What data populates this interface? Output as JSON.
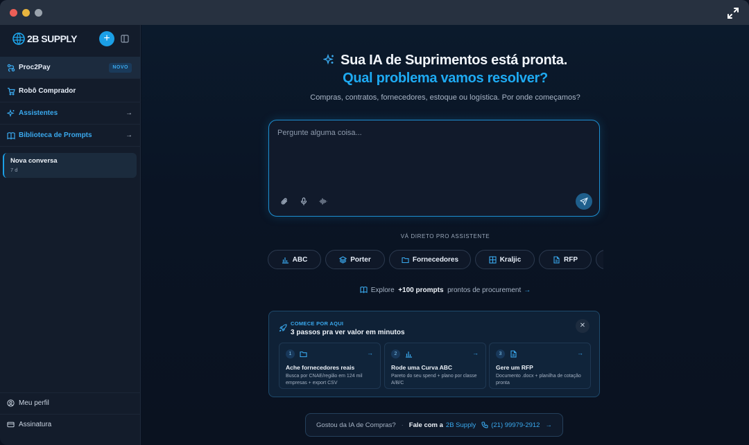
{
  "colors": {
    "accent": "#1eaaf2",
    "sidebar_bg": "#131c2b",
    "main_bg": "#0a1220"
  },
  "sidebar": {
    "logo_text": "2B SUPPLY",
    "new_button": "+",
    "items": [
      {
        "label": "Proc2Pay",
        "badge": "NOVO",
        "icon": "route-icon"
      },
      {
        "label": "Robô Comprador",
        "icon": "cart-icon"
      },
      {
        "label": "Assistentes",
        "icon": "sparkle-icon",
        "arrow": "→"
      },
      {
        "label": "Biblioteca de Prompts",
        "icon": "book-icon",
        "arrow": "→"
      }
    ],
    "conversation": {
      "title": "Nova conversa",
      "time": "7 d"
    },
    "bottom": [
      {
        "label": "Meu perfil",
        "icon": "user-icon"
      },
      {
        "label": "Assinatura",
        "icon": "card-icon"
      }
    ]
  },
  "hero": {
    "title": "Sua IA de Suprimentos está pronta.",
    "subtitle": "Qual problema vamos resolver?",
    "description": "Compras, contratos, fornecedores, estoque ou logística. Por onde começamos?"
  },
  "prompt": {
    "placeholder": "Pergunte alguma coisa..."
  },
  "assistants": {
    "label": "VÁ DIRETO PRO ASSISTENTE",
    "chips": [
      "ABC",
      "Porter",
      "Fornecedores",
      "Kraljic",
      "RFP"
    ]
  },
  "explore": {
    "prefix": "Explore",
    "highlight": "+100 prompts",
    "suffix": "prontos de procurement",
    "arrow": "→"
  },
  "onboarding": {
    "eyebrow": "COMECE POR AQUI",
    "title": "3 passos pra ver valor em minutos",
    "close": "✕",
    "steps": [
      {
        "num": "1",
        "title": "Ache fornecedores reais",
        "desc": "Busca por CNAE/região em 124 mil empresas + export CSV"
      },
      {
        "num": "2",
        "title": "Rode uma Curva ABC",
        "desc": "Pareto do seu spend + plano por classe A/B/C"
      },
      {
        "num": "3",
        "title": "Gere um RFP",
        "desc": "Documento .docx + planilha de cotação pronta"
      }
    ]
  },
  "footer": {
    "question": "Gostou da IA de Compras?",
    "sep": "·",
    "cta": "Fale com a",
    "brand": "2B Supply",
    "phone": "(21) 99979-2912",
    "arrow": "→"
  }
}
